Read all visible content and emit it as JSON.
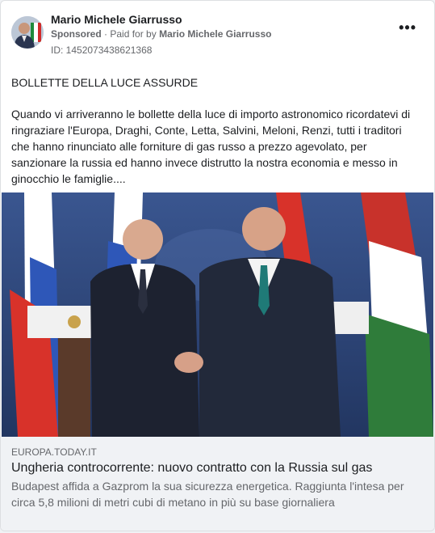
{
  "post": {
    "page_name": "Mario Michele Giarrusso",
    "sponsored_label": "Sponsored",
    "paid_for_prefix": "Paid for by",
    "paid_for_name": "Mario Michele Giarrusso",
    "ad_id": "ID: 1452073438621368",
    "more_icon": "more-horizontal-icon",
    "title_line": "BOLLETTE DELLA LUCE ASSURDE",
    "body_text": "Quando vi arriveranno le bollette della luce di importo astronomico ricordatevi di ringraziare l'Europa, Draghi, Conte, Letta, Salvini, Meloni, Renzi, tutti i traditori che hanno rinunciato alle forniture di gas russo a prezzo agevolato, per sanzionare la russia ed hanno invece distrutto la nostra economia e messo in ginocchio le famiglie...."
  },
  "link": {
    "domain": "EUROPA.TODAY.IT",
    "headline": "Ungheria controcorrente: nuovo contratto con la Russia sul gas",
    "description": "Budapest affida a Gazprom la sua sicurezza energetica. Raggiunta l'intesa per circa 5,8 milioni di metri cubi di metano in più su base giornaliera"
  },
  "colors": {
    "card_bg": "#ffffff",
    "link_bg": "#f0f2f5",
    "muted_text": "#65676b",
    "primary_text": "#1c1e21",
    "photo_backdrop": "#2c4372"
  }
}
